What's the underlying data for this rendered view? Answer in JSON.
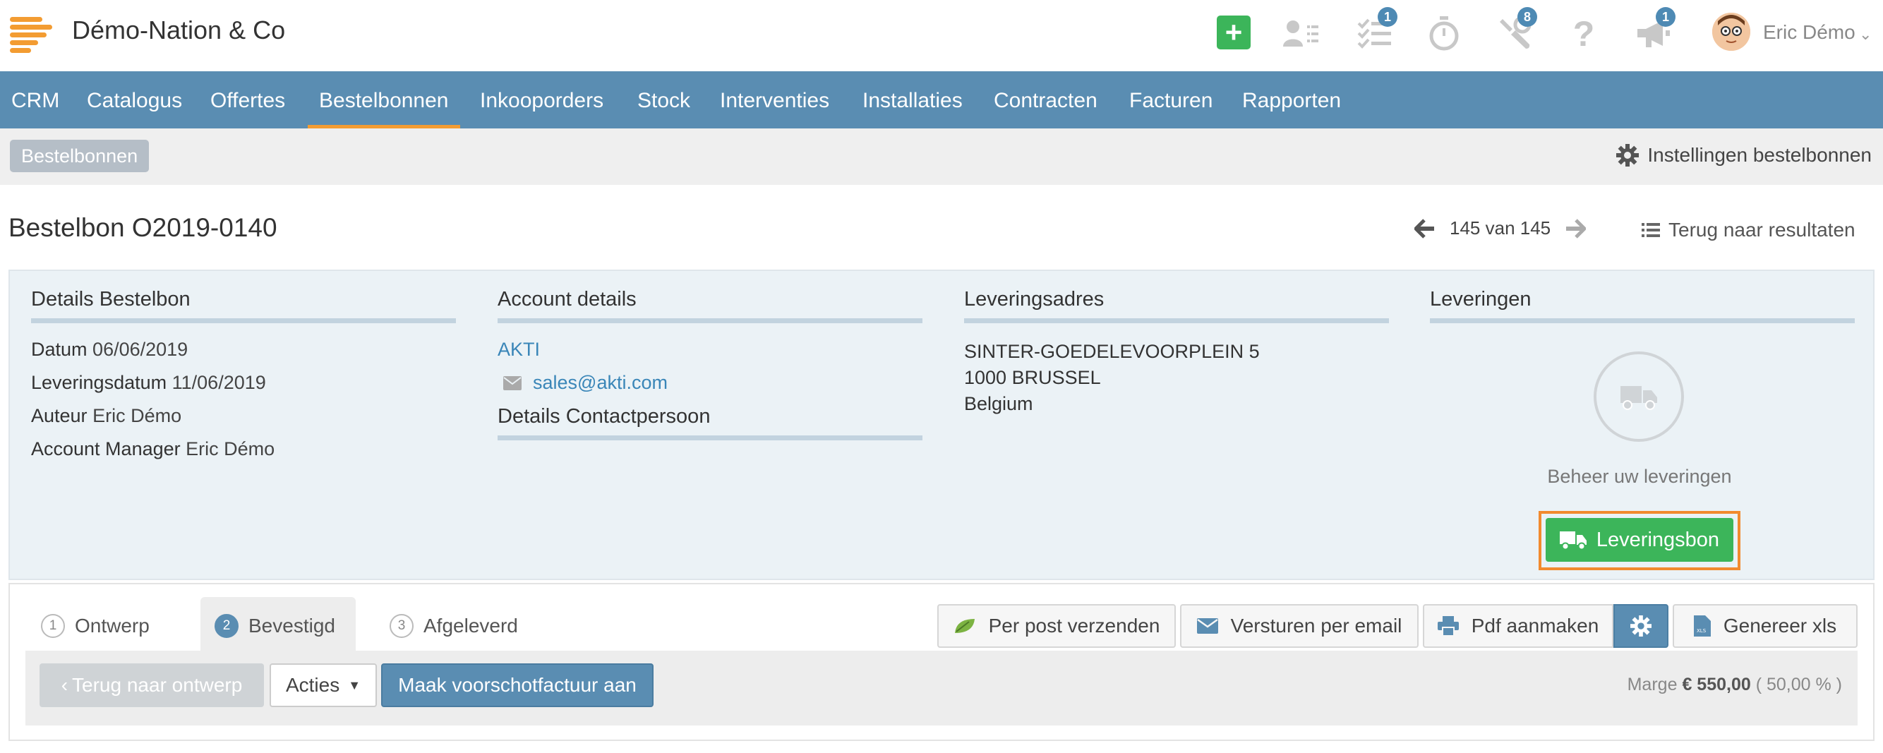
{
  "app": {
    "company_name": "Démo-Nation & Co",
    "brand_color": "#f39c32",
    "accent_color": "#5a8db2",
    "success_color": "#3cb55a"
  },
  "topbar": {
    "icons": [
      {
        "name": "add-icon"
      },
      {
        "name": "contacts-icon"
      },
      {
        "name": "tasks-icon",
        "badge": "1"
      },
      {
        "name": "timer-icon"
      },
      {
        "name": "tools-icon",
        "badge": "8"
      },
      {
        "name": "help-icon"
      },
      {
        "name": "announcements-icon",
        "badge": "1"
      }
    ],
    "user_name": "Eric Démo"
  },
  "nav": {
    "items": [
      "CRM",
      "Catalogus",
      "Offertes",
      "Bestelbonnen",
      "Inkooporders",
      "Stock",
      "Interventies",
      "Installaties",
      "Contracten",
      "Facturen",
      "Rapporten"
    ],
    "active": "Bestelbonnen"
  },
  "subbar": {
    "breadcrumb": "Bestelbonnen",
    "settings_label": "Instellingen bestelbonnen"
  },
  "header": {
    "title": "Bestelbon O2019-0140",
    "pager_text": "145 van 145",
    "back_label": "Terug naar resultaten"
  },
  "details": {
    "heading": "Details Bestelbon",
    "datum_label": "Datum",
    "datum_value": "06/06/2019",
    "leveringsdatum_label": "Leveringsdatum",
    "leveringsdatum_value": "11/06/2019",
    "auteur_label": "Auteur",
    "auteur_value": "Eric Démo",
    "manager_label": "Account Manager",
    "manager_value": "Eric Démo"
  },
  "account": {
    "heading": "Account details",
    "name": "AKTI",
    "email": "sales@akti.com",
    "contact_heading": "Details Contactpersoon"
  },
  "address": {
    "heading": "Leveringsadres",
    "line1": "SINTER-GOEDELEVOORPLEIN 5",
    "line2": "1000 BRUSSEL",
    "line3": "Belgium"
  },
  "deliveries": {
    "heading": "Leveringen",
    "manage_text": "Beheer uw leveringen",
    "button_label": "Leveringsbon"
  },
  "steps": [
    {
      "num": "1",
      "label": "Ontwerp"
    },
    {
      "num": "2",
      "label": "Bevestigd"
    },
    {
      "num": "3",
      "label": "Afgeleverd"
    }
  ],
  "toolbar": {
    "post_label": "Per post verzenden",
    "email_label": "Versturen per email",
    "pdf_label": "Pdf aanmaken",
    "xls_label": "Genereer xls"
  },
  "actions": {
    "back_label": "Terug naar ontwerp",
    "acties_label": "Acties",
    "invoice_label": "Maak voorschotfactuur aan",
    "marge_label": "Marge",
    "marge_value": "€ 550,00",
    "marge_pct": "( 50,00 % )"
  }
}
